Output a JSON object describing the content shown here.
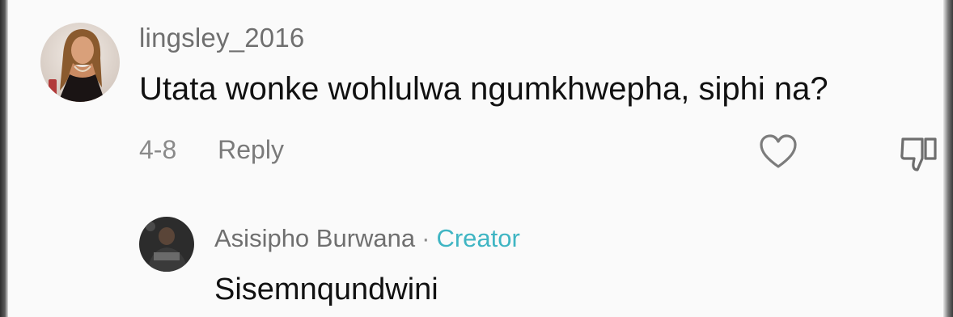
{
  "comment": {
    "username": "lingsley_2016",
    "text": "Utata wonke wohlulwa ngumkhwepha, siphi na?",
    "date": "4-8",
    "reply_label": "Reply",
    "like_icon": "heart-outline-icon",
    "dislike_icon": "thumbs-down-outline-icon"
  },
  "reply": {
    "username": "Asisipho Burwana",
    "separator": "·",
    "badge": "Creator",
    "text": "Sisemnqundwini"
  },
  "colors": {
    "creator_badge": "#3fb5c3",
    "username": "#6f6f6f",
    "meta": "#8a8a8a",
    "text": "#111111"
  }
}
